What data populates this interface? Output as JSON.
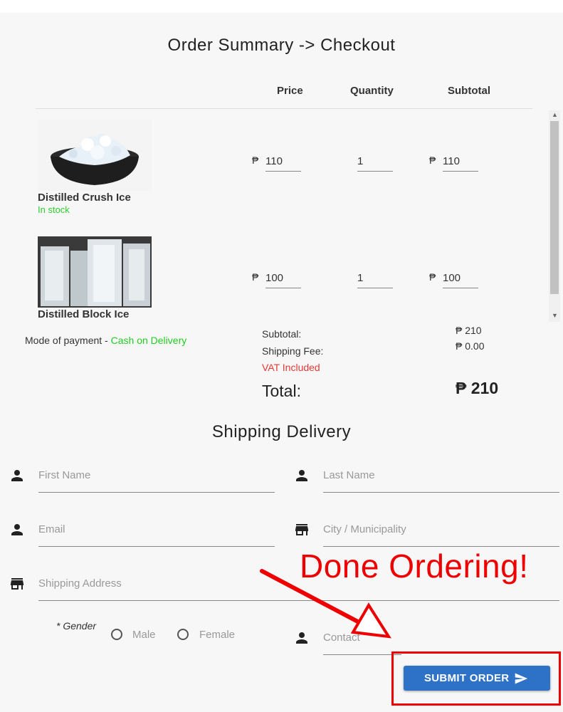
{
  "order": {
    "title": "Order Summary -> Checkout",
    "headers": {
      "price": "Price",
      "quantity": "Quantity",
      "subtotal": "Subtotal"
    },
    "currency": "₱",
    "items": [
      {
        "name": "Distilled Crush Ice",
        "status": "In stock",
        "price": "110",
        "quantity": "1",
        "subtotal": "110",
        "image": "crushed-ice-bowl"
      },
      {
        "name": "Distilled Block Ice",
        "status": "",
        "price": "100",
        "quantity": "1",
        "subtotal": "100",
        "image": "ice-blocks"
      }
    ],
    "payment_label": "Mode of payment - ",
    "payment_method": "Cash on Delivery",
    "subtotal_label": "Subtotal:",
    "subtotal_value": "₱ 210",
    "shipping_label": "Shipping Fee:",
    "shipping_value": "₱ 0.00",
    "vat_label": "VAT Included",
    "total_label": "Total:",
    "total_value": "₱ 210"
  },
  "shipping": {
    "title": "Shipping Delivery",
    "first_name": {
      "placeholder": "First Name",
      "icon": "person-icon"
    },
    "last_name": {
      "placeholder": "Last Name",
      "icon": "person-icon"
    },
    "email": {
      "placeholder": "Email",
      "icon": "person-icon"
    },
    "city": {
      "placeholder": "City / Municipality",
      "icon": "store-icon"
    },
    "address": {
      "placeholder": "Shipping Address",
      "icon": "store-icon"
    },
    "gender_label": "* Gender",
    "gender_options": [
      "Male",
      "Female"
    ],
    "contact": {
      "placeholder": "Contact",
      "icon": "person-icon"
    }
  },
  "submit": {
    "label": "SUBMIT ORDER",
    "icon": "send-icon"
  },
  "annotation": {
    "text": "Done Ordering!",
    "color": "#e00000"
  },
  "colors": {
    "accent": "#2e72c8",
    "in_stock": "#22cc22",
    "vat": "#e53935"
  }
}
